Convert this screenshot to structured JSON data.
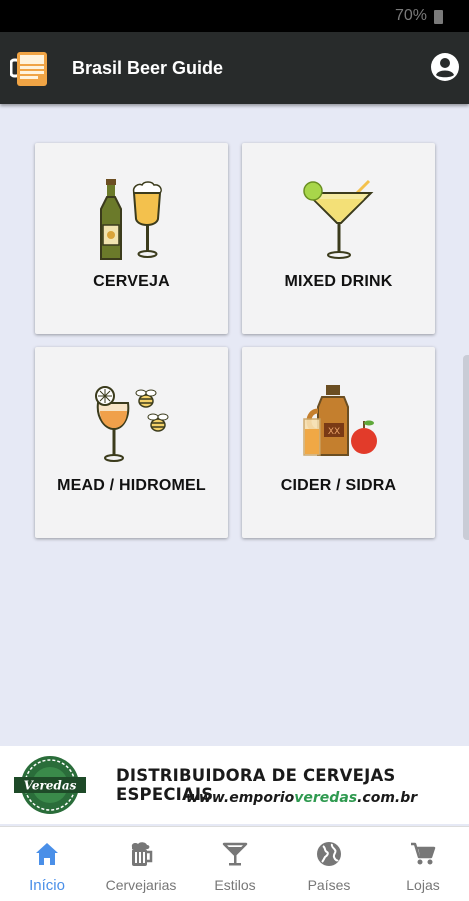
{
  "status_bar": {
    "battery_text": "70%"
  },
  "app": {
    "title": "Brasil Beer Guide"
  },
  "categories": [
    {
      "label": "CERVEJA",
      "icon": "beer-bottle-glass-icon"
    },
    {
      "label": "MIXED DRINK",
      "icon": "cocktail-icon"
    },
    {
      "label": "MEAD / HIDROMEL",
      "icon": "mead-glass-bees-icon"
    },
    {
      "label": "CIDER / SIDRA",
      "icon": "cider-jug-apple-icon"
    }
  ],
  "banner": {
    "brand": "Veredas",
    "title": "DISTRIBUIDORA DE CERVEJAS ESPECIAIS",
    "url_prefix": "www.emporio",
    "url_accent": "veredas",
    "url_suffix": ".com.br"
  },
  "bottom_nav": {
    "items": [
      {
        "label": "Início",
        "icon": "home-icon",
        "active": true
      },
      {
        "label": "Cervejarias",
        "icon": "beer-mug-icon",
        "active": false
      },
      {
        "label": "Estilos",
        "icon": "martini-glass-icon",
        "active": false
      },
      {
        "label": "Países",
        "icon": "globe-icon",
        "active": false
      },
      {
        "label": "Lojas",
        "icon": "shopping-cart-icon",
        "active": false
      }
    ]
  },
  "colors": {
    "appbar": "#282b2b",
    "background": "#e6e9f5",
    "active_nav": "#4a8fe8",
    "inactive_nav": "#777777"
  }
}
